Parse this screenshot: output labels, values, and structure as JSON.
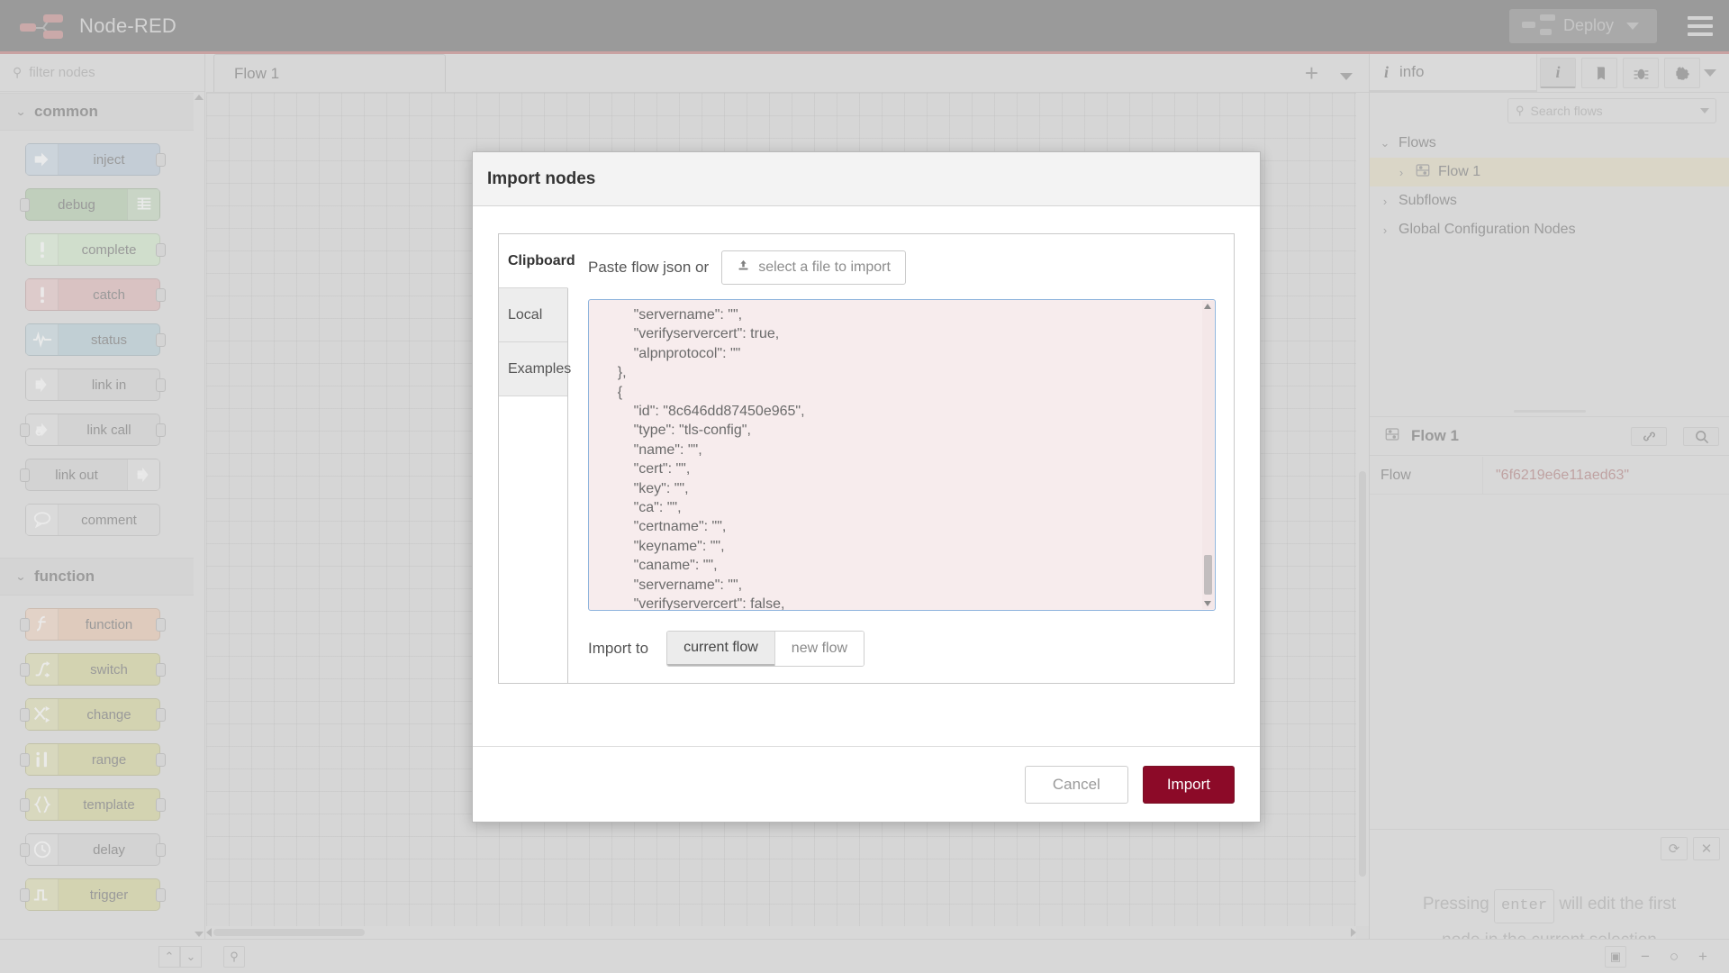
{
  "header": {
    "app_title": "Node-RED",
    "logo_icon": "node-red-logo-icon",
    "deploy_label": "Deploy",
    "deploy_icon": "deploy-nodes-icon",
    "deploy_caret_icon": "chevron-down-icon",
    "menu_icon": "hamburger-menu-icon"
  },
  "palette": {
    "filter_placeholder": "filter nodes",
    "filter_value": "",
    "search_icon": "search-icon",
    "categories": [
      {
        "label": "common",
        "chevron_icon": "chevron-down-icon",
        "nodes": [
          {
            "label": "inject",
            "icon": "inject-arrow-icon",
            "color": "#a6bbcf",
            "icon_side": "left",
            "in": false,
            "out": true
          },
          {
            "label": "debug",
            "icon": "debug-lines-icon",
            "color": "#9dbe94",
            "icon_side": "right",
            "in": true,
            "out": false
          },
          {
            "label": "complete",
            "icon": "exclamation-icon",
            "color": "#c0e0b8",
            "icon_side": "left",
            "in": false,
            "out": true
          },
          {
            "label": "catch",
            "icon": "exclamation-icon",
            "color": "#d4a2a2",
            "icon_side": "left",
            "in": false,
            "out": true
          },
          {
            "label": "status",
            "icon": "pulse-wave-icon",
            "color": "#a1bfc9",
            "icon_side": "left",
            "in": false,
            "out": true
          },
          {
            "label": "link in",
            "icon": "link-arrow-icon",
            "color": "#c8c8c8",
            "icon_side": "left",
            "in": false,
            "out": true
          },
          {
            "label": "link call",
            "icon": "link-call-icon",
            "color": "#c8c8c8",
            "icon_side": "left",
            "in": true,
            "out": true
          },
          {
            "label": "link out",
            "icon": "link-arrow-icon",
            "color": "#c8c8c8",
            "icon_side": "right",
            "in": true,
            "out": false
          },
          {
            "label": "comment",
            "icon": "comment-bubble-icon",
            "color": "#cecece",
            "icon_side": "left",
            "in": false,
            "out": false
          }
        ]
      },
      {
        "label": "function",
        "chevron_icon": "chevron-down-icon",
        "nodes": [
          {
            "label": "function",
            "icon": "function-f-icon",
            "color": "#e2b597",
            "icon_side": "left",
            "in": true,
            "out": true
          },
          {
            "label": "switch",
            "icon": "switch-fork-icon",
            "color": "#c7c77d",
            "icon_side": "left",
            "in": true,
            "out": true
          },
          {
            "label": "change",
            "icon": "change-swap-icon",
            "color": "#c7c77d",
            "icon_side": "left",
            "in": true,
            "out": true
          },
          {
            "label": "range",
            "icon": "range-bars-icon",
            "color": "#c7c77d",
            "icon_side": "left",
            "in": true,
            "out": true
          },
          {
            "label": "template",
            "icon": "template-braces-icon",
            "color": "#c7c77d",
            "icon_side": "left",
            "in": true,
            "out": true
          },
          {
            "label": "delay",
            "icon": "clock-icon",
            "color": "#c7c7c7",
            "icon_side": "left",
            "in": true,
            "out": true
          },
          {
            "label": "trigger",
            "icon": "trigger-step-icon",
            "color": "#c7c77d",
            "icon_side": "left",
            "in": true,
            "out": true
          }
        ]
      }
    ]
  },
  "workspace": {
    "tabs": [
      {
        "label": "Flow 1",
        "active": true
      }
    ],
    "add_tab_icon": "plus-icon",
    "tab_menu_icon": "chevron-down-icon"
  },
  "sidebar": {
    "tab_label": "info",
    "tab_icon": "info-i-icon",
    "buttons": [
      {
        "name": "information-icon",
        "active": true
      },
      {
        "name": "help-book-icon",
        "active": false
      },
      {
        "name": "debug-bug-icon",
        "active": false
      },
      {
        "name": "settings-gear-icon",
        "active": false
      }
    ],
    "menu_icon": "chevron-down-icon",
    "search_placeholder": "Search flows",
    "search_value": "",
    "search_icon": "search-icon",
    "search_caret_icon": "chevron-down-icon",
    "tree": [
      {
        "label": "Flows",
        "level": 0,
        "chevron": "⌄",
        "selected": false,
        "icon": null
      },
      {
        "label": "Flow 1",
        "level": 1,
        "chevron": "›",
        "selected": true,
        "icon": "flow-tab-icon"
      },
      {
        "label": "Subflows",
        "level": 0,
        "chevron": "›",
        "selected": false,
        "icon": null
      },
      {
        "label": "Global Configuration Nodes",
        "level": 0,
        "chevron": "›",
        "selected": false,
        "icon": null
      }
    ],
    "flow_header": {
      "title": "Flow 1",
      "icon": "flow-tab-icon",
      "link_icon": "link-icon",
      "search_icon": "search-icon"
    },
    "properties": [
      {
        "key": "Flow",
        "value": "\"6f6219e6e11aed63\""
      }
    ],
    "footer_buttons": [
      {
        "name": "refresh-icon",
        "glyph": "⟳"
      },
      {
        "name": "close-icon",
        "glyph": "✕"
      }
    ],
    "hint_prefix": "Pressing",
    "hint_key": "enter",
    "hint_suffix": "will edit the first",
    "hint_line2": "node in the current selection"
  },
  "dialog": {
    "title": "Import nodes",
    "source_tabs": [
      {
        "label": "Clipboard",
        "active": true
      },
      {
        "label": "Local",
        "active": false
      },
      {
        "label": "Examples",
        "active": false
      }
    ],
    "paste_label": "Paste flow json or",
    "file_button_label": "select a file to import",
    "file_button_icon": "upload-icon",
    "json_text": "        \"servername\": \"\",\n        \"verifyservercert\": true,\n        \"alpnprotocol\": \"\"\n    },\n    {\n        \"id\": \"8c646dd87450e965\",\n        \"type\": \"tls-config\",\n        \"name\": \"\",\n        \"cert\": \"\",\n        \"key\": \"\",\n        \"ca\": \"\",\n        \"certname\": \"\",\n        \"keyname\": \"\",\n        \"caname\": \"\",\n        \"servername\": \"\",\n        \"verifyservercert\": false,\n        \"alpnprotocol\": \"\"\n    }\n]",
    "import_to_label": "Import to",
    "import_to_options": [
      {
        "label": "current flow",
        "active": true
      },
      {
        "label": "new flow",
        "active": false
      }
    ],
    "cancel_label": "Cancel",
    "import_label": "Import",
    "import_button_color": "#8c0a28"
  },
  "footer": {
    "buttons": [
      {
        "name": "collapse-all-icon",
        "glyph": "⌃"
      },
      {
        "name": "expand-all-icon",
        "glyph": "⌄"
      }
    ],
    "search_icon": "search-icon",
    "right_buttons": [
      {
        "name": "navigator-icon",
        "glyph": "▣"
      },
      {
        "name": "zoom-out-icon",
        "glyph": "−"
      },
      {
        "name": "zoom-reset-icon",
        "glyph": "○"
      },
      {
        "name": "zoom-in-icon",
        "glyph": "+"
      }
    ]
  },
  "colors": {
    "header_bg": "#4b4b4b",
    "accent_red": "#b25c5c",
    "import_red": "#8c0a28",
    "selection_tan": "#d8cfad",
    "json_bg": "#f7eced"
  }
}
